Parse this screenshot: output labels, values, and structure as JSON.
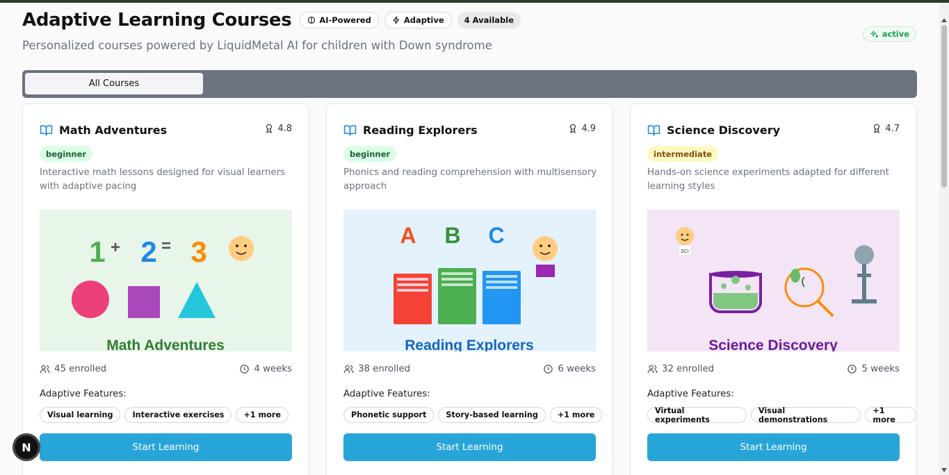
{
  "header": {
    "title": "Adaptive Learning Courses",
    "badges": [
      {
        "label": "AI-Powered",
        "icon": "brain-icon"
      },
      {
        "label": "Adaptive",
        "icon": "zap-icon"
      },
      {
        "label": "4 Available"
      }
    ],
    "subtitle": "Personalized courses powered by LiquidMetal AI for children with Down syndrome",
    "status": {
      "label": "active",
      "icon": "sparkles-icon",
      "color": "#16a34a"
    }
  },
  "tabs": [
    {
      "label": "All Courses",
      "selected": true
    }
  ],
  "colors": {
    "accent": "#27a5d9",
    "tabbar": "#6b7280",
    "beginner_bg": "#dcfce7",
    "intermediate_bg": "#fef9c3"
  },
  "courses": [
    {
      "title": "Math Adventures",
      "rating": "4.8",
      "level": "beginner",
      "description": "Interactive math lessons designed for visual learners with adaptive pacing",
      "image": {
        "bg": "#e8f5e9",
        "caption": "Math Adventures",
        "caption_color": "#2e7d32",
        "equation": [
          "1",
          "+",
          "2",
          "=",
          "3"
        ]
      },
      "enrolled": "45 enrolled",
      "duration": "4 weeks",
      "features_label": "Adaptive Features:",
      "features": [
        "Visual learning",
        "Interactive exercises",
        "+1 more"
      ],
      "button": "Start Learning"
    },
    {
      "title": "Reading Explorers",
      "rating": "4.9",
      "level": "beginner",
      "description": "Phonics and reading comprehension with multisensory approach",
      "image": {
        "bg": "#e3f2fd",
        "caption": "Reading Explorers",
        "caption_color": "#1565c0",
        "letters": [
          "A",
          "B",
          "C"
        ]
      },
      "enrolled": "38 enrolled",
      "duration": "6 weeks",
      "features_label": "Adaptive Features:",
      "features": [
        "Phonetic support",
        "Story-based learning",
        "+1 more"
      ],
      "button": "Start Learning"
    },
    {
      "title": "Science Discovery",
      "rating": "4.7",
      "level": "intermediate",
      "description": "Hands-on science experiments adapted for different learning styles",
      "image": {
        "bg": "#f3e5f5",
        "caption": "Science Discovery",
        "caption_color": "#6a1b9a",
        "tag": "SCI"
      },
      "enrolled": "32 enrolled",
      "duration": "5 weeks",
      "features_label": "Adaptive Features:",
      "features": [
        "Virtual experiments",
        "Visual demonstrations",
        "+1 more"
      ],
      "button": "Start Learning"
    }
  ],
  "dev_badge": "N"
}
